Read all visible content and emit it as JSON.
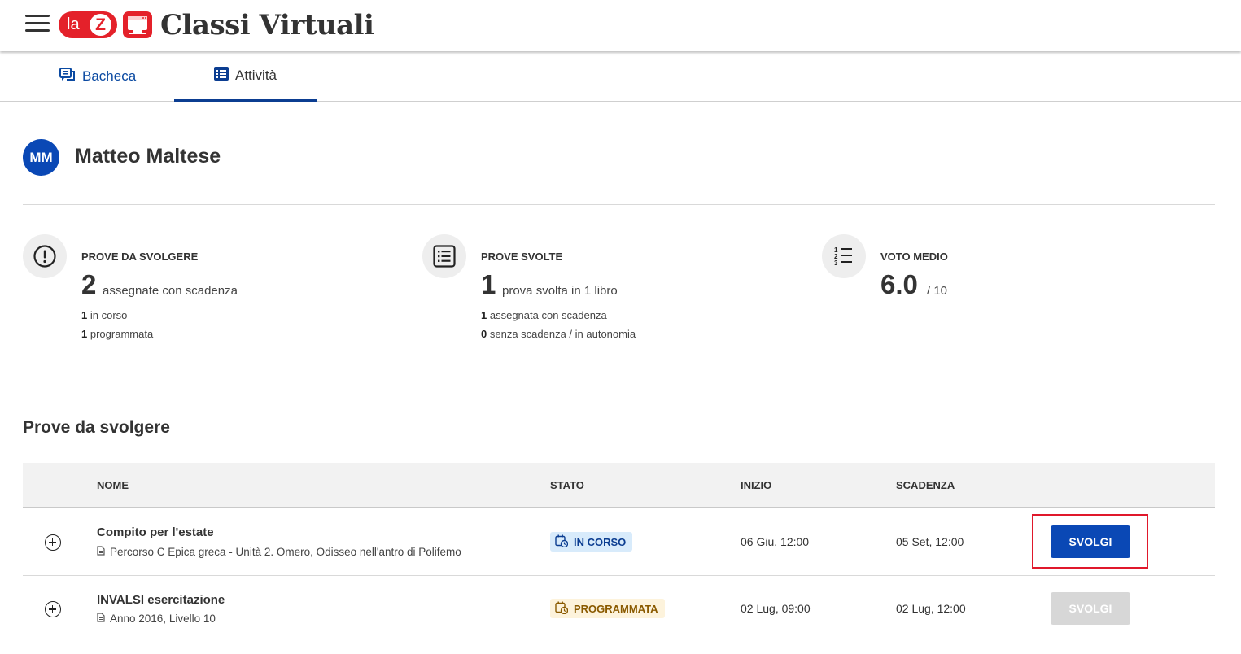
{
  "header": {
    "app_title": "Classi Virtuali",
    "logo_text_la": "la",
    "logo_text_z": "Z",
    "brand_color": "#e4212a"
  },
  "tabs": [
    {
      "label": "Bacheca",
      "icon": "board-icon",
      "active": false
    },
    {
      "label": "Attività",
      "icon": "list-icon",
      "active": true
    }
  ],
  "user": {
    "initials": "MM",
    "name": "Matteo Maltese"
  },
  "stats": {
    "da_svolgere": {
      "label": "PROVE DA SVOLGERE",
      "value": "2",
      "after": "assegnate con scadenza",
      "lines": [
        {
          "count": "1",
          "text": "in corso"
        },
        {
          "count": "1",
          "text": "programmata"
        }
      ]
    },
    "svolte": {
      "label": "PROVE SVOLTE",
      "value": "1",
      "after": "prova svolta in 1 libro",
      "lines": [
        {
          "count": "1",
          "text": "assegnata con scadenza"
        },
        {
          "count": "0",
          "text": "senza scadenza / in autonomia"
        }
      ]
    },
    "voto": {
      "label": "VOTO MEDIO",
      "value": "6.0",
      "after": "/ 10"
    }
  },
  "section_title": "Prove da svolgere",
  "table": {
    "headers": {
      "nome": "NOME",
      "stato": "STATO",
      "inizio": "INIZIO",
      "scadenza": "SCADENZA"
    },
    "rows": [
      {
        "name": "Compito per l'estate",
        "sub": "Percorso C Epica greca - Unità 2. Omero, Odisseo nell'antro di Polifemo",
        "status": "IN CORSO",
        "inizio": "06 Giu, 12:00",
        "scadenza": "05 Set, 12:00",
        "action": "SVOLGI",
        "action_enabled": true
      },
      {
        "name": "INVALSI esercitazione",
        "sub": "Anno 2016, Livello 10",
        "status": "PROGRAMMATA",
        "inizio": "02 Lug, 09:00",
        "scadenza": "02 Lug, 12:00",
        "action": "SVOLGI",
        "action_enabled": false
      }
    ]
  },
  "colors": {
    "primary": "#0a48b5",
    "highlight": "#e0182b",
    "badge_in_corso": "#d8ebfb",
    "badge_programmata": "#fdf3dc"
  }
}
